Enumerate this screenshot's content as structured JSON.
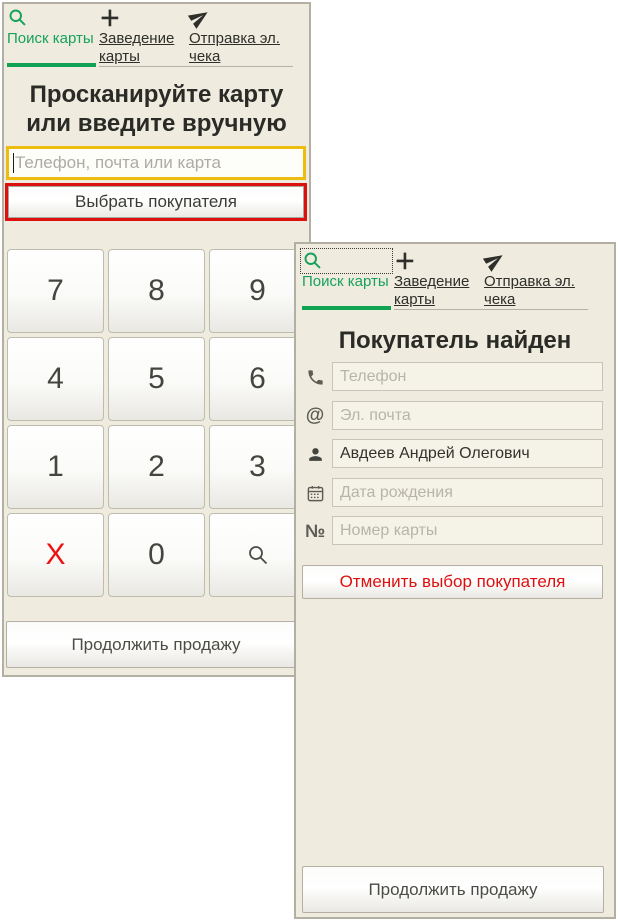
{
  "colors": {
    "panel_bg": "#efecdf",
    "panel_border": "#b3b0a3",
    "accent_green": "#17a15c",
    "alert_red": "#dd1010",
    "input_focus_gold": "#ecbc10"
  },
  "left_panel": {
    "tabs": [
      {
        "label": "Поиск карты",
        "icon": "search-icon",
        "active": true
      },
      {
        "label": "Заведение карты",
        "icon": "plus-icon",
        "active": false
      },
      {
        "label": "Отправка эл. чека",
        "icon": "send-icon",
        "active": false
      }
    ],
    "title": "Просканируйте карту или введите вручную",
    "search_input": {
      "placeholder": "Телефон, почта или карта",
      "value": ""
    },
    "select_customer_button": "Выбрать покупателя",
    "keypad": {
      "rows": [
        [
          "7",
          "8",
          "9"
        ],
        [
          "4",
          "5",
          "6"
        ],
        [
          "1",
          "2",
          "3"
        ]
      ],
      "clear_key": "X",
      "zero_key": "0",
      "search_key_icon": "search-icon"
    },
    "continue_button": "Продолжить продажу"
  },
  "right_panel": {
    "tabs": [
      {
        "label": "Поиск карты",
        "icon": "search-icon",
        "active": true
      },
      {
        "label": "Заведение карты",
        "icon": "plus-icon",
        "active": false
      },
      {
        "label": "Отправка эл. чека",
        "icon": "send-icon",
        "active": false
      }
    ],
    "title": "Покупатель найден",
    "fields": [
      {
        "icon": "phone-icon",
        "placeholder": "Телефон",
        "value": ""
      },
      {
        "icon": "at-icon",
        "placeholder": "Эл. почта",
        "value": ""
      },
      {
        "icon": "person-icon",
        "placeholder": "",
        "value": "Авдеев Андрей Олегович"
      },
      {
        "icon": "calendar-icon",
        "placeholder": "Дата рождения",
        "value": ""
      },
      {
        "icon": "card-number-icon",
        "placeholder": "Номер карты",
        "value": ""
      }
    ],
    "at_glyph": "@",
    "numero_glyph": "№",
    "cancel_selection_button": "Отменить выбор покупателя",
    "continue_button": "Продолжить продажу"
  }
}
